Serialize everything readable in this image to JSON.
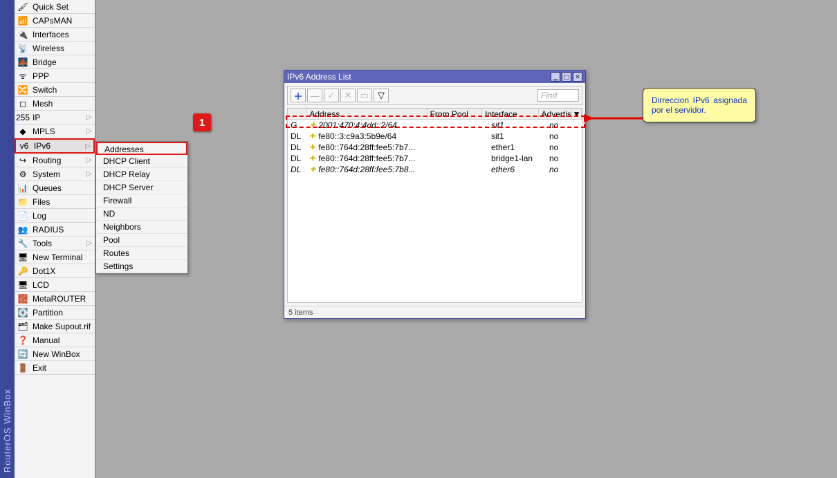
{
  "brand": "RouterOS WinBox",
  "sidebar": {
    "items": [
      {
        "label": "Quick Set",
        "icon": "🖌",
        "arrow": false
      },
      {
        "label": "CAPsMAN",
        "icon": "📶",
        "arrow": false
      },
      {
        "label": "Interfaces",
        "icon": "🔌",
        "arrow": false
      },
      {
        "label": "Wireless",
        "icon": "📡",
        "arrow": false
      },
      {
        "label": "Bridge",
        "icon": "🌉",
        "arrow": false
      },
      {
        "label": "PPP",
        "icon": "ᯤ",
        "arrow": false
      },
      {
        "label": "Switch",
        "icon": "🔀",
        "arrow": false
      },
      {
        "label": "Mesh",
        "icon": "◻",
        "arrow": false
      },
      {
        "label": "IP",
        "icon": "255",
        "arrow": true
      },
      {
        "label": "MPLS",
        "icon": "◆",
        "arrow": true
      },
      {
        "label": "IPv6",
        "icon": "v6",
        "arrow": true,
        "selected": true
      },
      {
        "label": "Routing",
        "icon": "↪",
        "arrow": true
      },
      {
        "label": "System",
        "icon": "⚙",
        "arrow": true
      },
      {
        "label": "Queues",
        "icon": "📊",
        "arrow": false
      },
      {
        "label": "Files",
        "icon": "📁",
        "arrow": false
      },
      {
        "label": "Log",
        "icon": "📄",
        "arrow": false
      },
      {
        "label": "RADIUS",
        "icon": "👥",
        "arrow": false
      },
      {
        "label": "Tools",
        "icon": "🔧",
        "arrow": true
      },
      {
        "label": "New Terminal",
        "icon": "🖥",
        "arrow": false
      },
      {
        "label": "Dot1X",
        "icon": "🔑",
        "arrow": false
      },
      {
        "label": "LCD",
        "icon": "🖥",
        "arrow": false
      },
      {
        "label": "MetaROUTER",
        "icon": "🧱",
        "arrow": false
      },
      {
        "label": "Partition",
        "icon": "💽",
        "arrow": false
      },
      {
        "label": "Make Supout.rif",
        "icon": "🗂",
        "arrow": false
      },
      {
        "label": "Manual",
        "icon": "❓",
        "arrow": false
      },
      {
        "label": "New WinBox",
        "icon": "🔄",
        "arrow": false
      },
      {
        "label": "Exit",
        "icon": "🚪",
        "arrow": false
      }
    ]
  },
  "submenu": {
    "items": [
      {
        "label": "Addresses",
        "highlight": true
      },
      {
        "label": "DHCP Client"
      },
      {
        "label": "DHCP Relay"
      },
      {
        "label": "DHCP Server"
      },
      {
        "label": "Firewall"
      },
      {
        "label": "ND"
      },
      {
        "label": "Neighbors"
      },
      {
        "label": "Pool"
      },
      {
        "label": "Routes"
      },
      {
        "label": "Settings"
      }
    ]
  },
  "win": {
    "title": "IPv6 Address List",
    "find_placeholder": "Find",
    "toolbar": {
      "add": "＋",
      "remove": "—",
      "apply": "✓",
      "cancel": "✕",
      "comment": "▭",
      "filter": "▽"
    },
    "cols": {
      "flag": "",
      "address": "Address",
      "from_pool": "From Pool",
      "interface": "Interface",
      "advertise": "Advertise"
    },
    "rows": [
      {
        "flag": "G",
        "address": "2001:470:4:4dd::2/64",
        "from_pool": "",
        "interface": "sit1",
        "advertise": "no",
        "italic": true,
        "highlight": true
      },
      {
        "flag": "DL",
        "address": "fe80::3:c9a3:5b9e/64",
        "from_pool": "",
        "interface": "sit1",
        "advertise": "no",
        "italic": false
      },
      {
        "flag": "DL",
        "address": "fe80::764d:28ff:fee5:7b7...",
        "from_pool": "",
        "interface": "ether1",
        "advertise": "no",
        "italic": false
      },
      {
        "flag": "DL",
        "address": "fe80::764d:28ff:fee5:7b7...",
        "from_pool": "",
        "interface": "bridge1-lan",
        "advertise": "no",
        "italic": false
      },
      {
        "flag": "DL",
        "address": "fe80::764d:28ff:fee5:7b8...",
        "from_pool": "",
        "interface": "ether6",
        "advertise": "no",
        "italic": true
      }
    ],
    "status": "5 items"
  },
  "badge": "1",
  "callout": "Dirreccion IPv6 asignada por el servidor."
}
